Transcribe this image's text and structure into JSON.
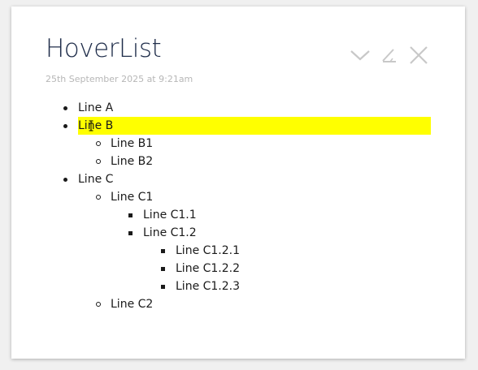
{
  "note": {
    "title": "HoverList",
    "timestamp": "25th September 2025 at 9:21am"
  },
  "toolbar": {
    "icons": [
      "check-icon",
      "edit-icon",
      "close-icon"
    ],
    "icon_color": "#c8c8c8"
  },
  "list": {
    "highlight_color": "#ffff00",
    "items": [
      {
        "label": "Line A"
      },
      {
        "label": "Line B",
        "highlighted": true
      },
      {
        "label": "Line B1"
      },
      {
        "label": "Line B2"
      },
      {
        "label": "Line C"
      },
      {
        "label": "Line C1"
      },
      {
        "label": "Line C1.1"
      },
      {
        "label": "Line C1.2"
      },
      {
        "label": "Line C1.2.1"
      },
      {
        "label": "Line C1.2.2"
      },
      {
        "label": "Line C1.2.3"
      },
      {
        "label": "Line C2"
      }
    ]
  }
}
